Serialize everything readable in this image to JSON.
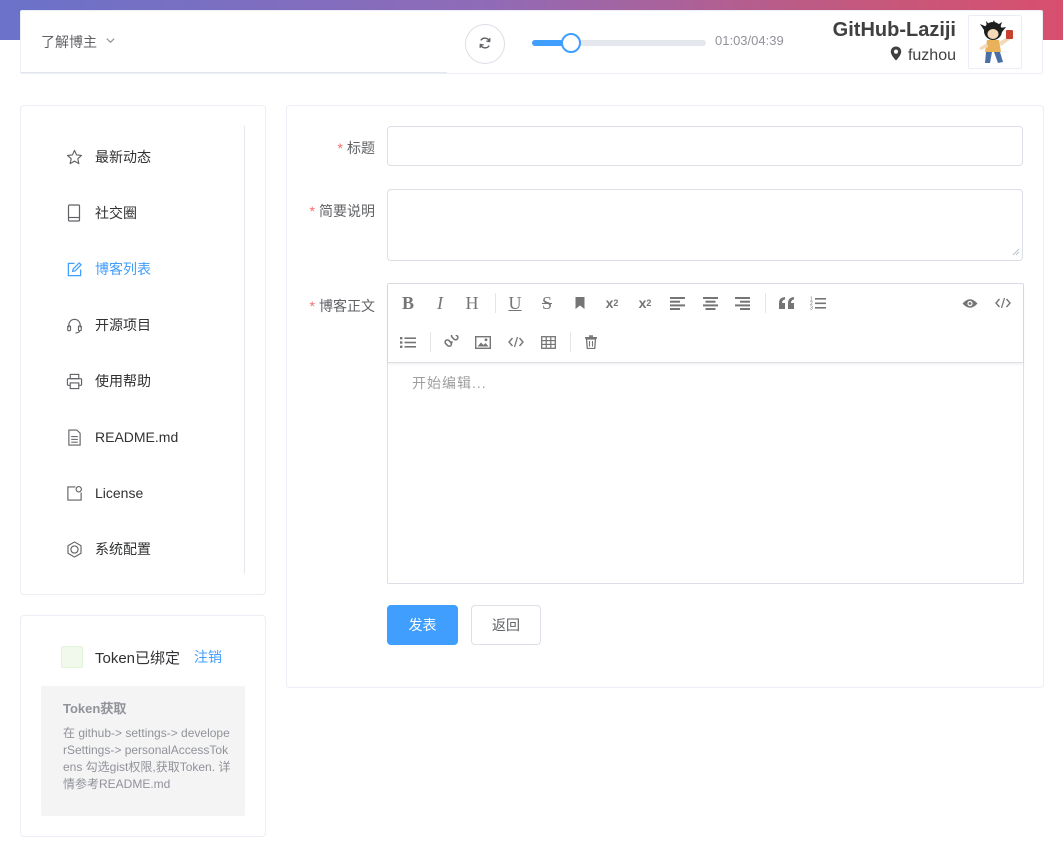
{
  "header": {
    "menu_label": "了解博主",
    "player": {
      "time": "01:03/04:39",
      "progress": 0.227
    },
    "user": {
      "name": "GitHub-Laziji",
      "location": "fuzhou"
    }
  },
  "sidebar": {
    "items": [
      {
        "label": "最新动态",
        "icon": "star-icon",
        "active": false
      },
      {
        "label": "社交圈",
        "icon": "tablet-icon",
        "active": false
      },
      {
        "label": "博客列表",
        "icon": "edit-icon",
        "active": true
      },
      {
        "label": "开源项目",
        "icon": "headset-icon",
        "active": false
      },
      {
        "label": "使用帮助",
        "icon": "printer-icon",
        "active": false
      },
      {
        "label": "README.md",
        "icon": "document-icon",
        "active": false
      },
      {
        "label": "License",
        "icon": "license-icon",
        "active": false
      },
      {
        "label": "系统配置",
        "icon": "gear-icon",
        "active": false
      }
    ],
    "active_color": "#409eff"
  },
  "token": {
    "status": "Token已绑定",
    "logout": "注销",
    "help_title": "Token获取",
    "help_text": "在 github-> settings-> developerSettings-> personalAccessTokens 勾选gist权限,获取Token. 详情参考README.md"
  },
  "form": {
    "title_label": "标题",
    "summary_label": "简要说明",
    "body_label": "博客正文",
    "required_mark": "*",
    "title_value": "",
    "summary_value": "",
    "editor_placeholder": "开始编辑...",
    "publish_button": "发表",
    "back_button": "返回"
  },
  "colors": {
    "primary": "#409eff",
    "required": "#f56c6c"
  }
}
